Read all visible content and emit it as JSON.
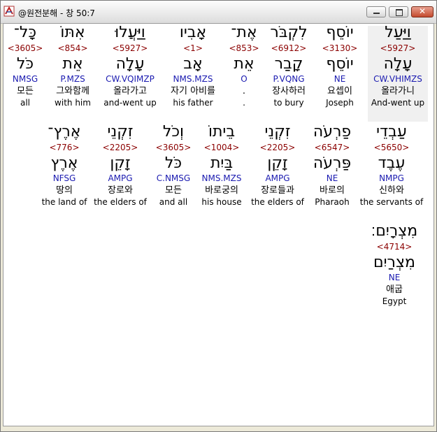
{
  "window": {
    "title": "@원전분해 - 창 50:7"
  },
  "verse": [
    {
      "heb": "וַיַּעַל",
      "strong": "<5927>",
      "lemma": "עָלָה",
      "parse": "CW.VHIMZS",
      "korean": "올라가니",
      "english": "And-went up"
    },
    {
      "heb": "יוֹסֵף",
      "strong": "<3130>",
      "lemma": "יוֹסֵף",
      "parse": "NE",
      "korean": "요셉이",
      "english": "Joseph"
    },
    {
      "heb": "לִקְבֹּר",
      "strong": "<6912>",
      "lemma": "קָבַר",
      "parse": "P.VQNG",
      "korean": "장사하러",
      "english": "to bury"
    },
    {
      "heb": "אֶת־",
      "strong": "<853>",
      "lemma": "אֵת",
      "parse": "O",
      "korean": ".",
      "english": "."
    },
    {
      "heb": "אָבִיו",
      "strong": "<1>",
      "lemma": "אָב",
      "parse": "NMS.MZS",
      "korean": "자기 아비를",
      "english": "his father"
    },
    {
      "heb": "וַיַּעֲלוּ",
      "strong": "<5927>",
      "lemma": "עָלָה",
      "parse": "CW.VQIMZP",
      "korean": "올라가고",
      "english": "and-went up"
    },
    {
      "heb": "אִתּוֹ",
      "strong": "<854>",
      "lemma": "אֵת",
      "parse": "P.MZS",
      "korean": "그와함께",
      "english": "with him"
    },
    {
      "heb": "כָּל־",
      "strong": "<3605>",
      "lemma": "כֹּל",
      "parse": "NMSG",
      "korean": "모든",
      "english": "all"
    },
    {
      "heb": "עַבְדֵי",
      "strong": "<5650>",
      "lemma": "עֶבֶד",
      "parse": "NMPG",
      "korean": "신하와",
      "english": "the servants of"
    },
    {
      "heb": "פַרְעֹה",
      "strong": "<6547>",
      "lemma": "פַּרְעֹה",
      "parse": "NE",
      "korean": "바로의",
      "english": "Pharaoh"
    },
    {
      "heb": "זִקְנֵי",
      "strong": "<2205>",
      "lemma": "זָקֵן",
      "parse": "AMPG",
      "korean": "장로들과",
      "english": "the elders of"
    },
    {
      "heb": "בֵיתוֹ",
      "strong": "<1004>",
      "lemma": "בַּיִת",
      "parse": "NMS.MZS",
      "korean": "바로궁의",
      "english": "his house"
    },
    {
      "heb": "וְכֹל",
      "strong": "<3605>",
      "lemma": "כֹּל",
      "parse": "C.NMSG",
      "korean": "모든",
      "english": "and all"
    },
    {
      "heb": "זִקְנֵי",
      "strong": "<2205>",
      "lemma": "זָקֵן",
      "parse": "AMPG",
      "korean": "장로와",
      "english": "the elders of"
    },
    {
      "heb": "אֶרֶץ־",
      "strong": "<776>",
      "lemma": "אֶרֶץ",
      "parse": "NFSG",
      "korean": "땅의",
      "english": "the land of"
    },
    {
      "heb": "מִצְרָיִם׃",
      "strong": "<4714>",
      "lemma": "מִצְרַיִם",
      "parse": "NE",
      "korean": "애굽",
      "english": "Egypt"
    }
  ]
}
